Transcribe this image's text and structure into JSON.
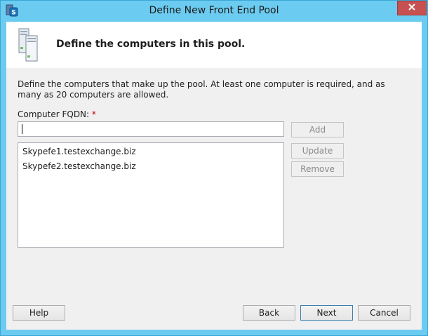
{
  "window": {
    "title": "Define New Front End Pool",
    "close_label": "✕"
  },
  "header": {
    "title": "Define the computers in this pool."
  },
  "description": "Define the computers that make up the pool. At least one computer is required, and as many as 20 computers are allowed.",
  "fqdn": {
    "label": "Computer FQDN:",
    "required_mark": "*",
    "value": ""
  },
  "computers": [
    "Skypefe1.testexchange.biz",
    "Skypefe2.testexchange.biz"
  ],
  "side_buttons": {
    "add": "Add",
    "update": "Update",
    "remove": "Remove"
  },
  "footer": {
    "help": "Help",
    "back": "Back",
    "next": "Next",
    "cancel": "Cancel"
  },
  "colors": {
    "titlebar": "#6ccbf0",
    "close_button": "#c75050",
    "required": "#c00000"
  }
}
